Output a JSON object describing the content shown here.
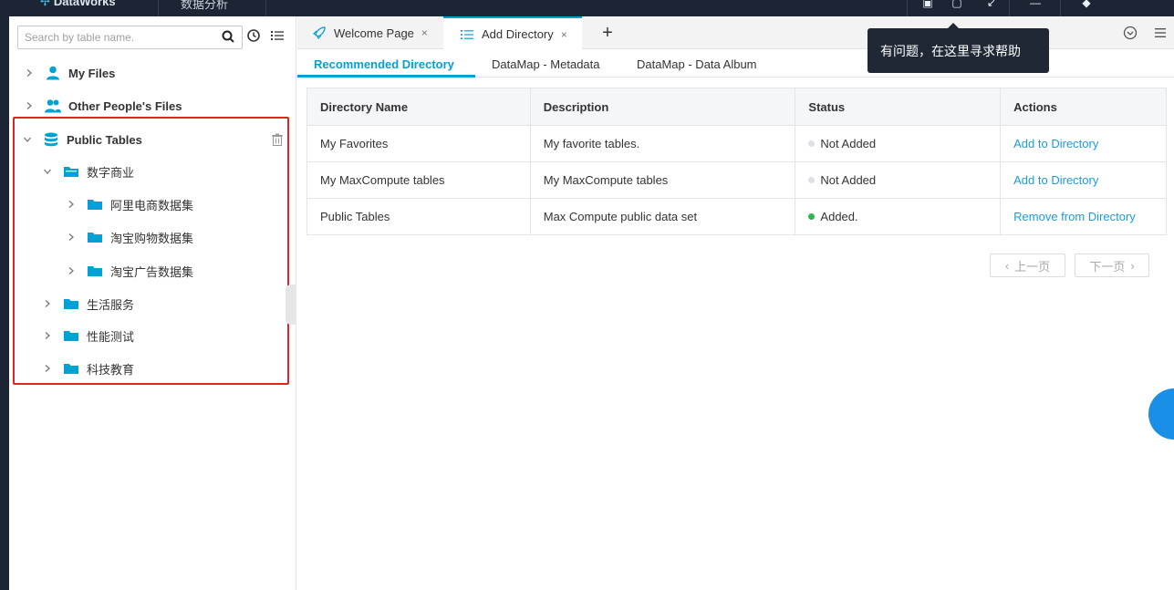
{
  "topbar": {
    "brand": "DataWorks",
    "workspace": "数据分析"
  },
  "sidebar": {
    "search_placeholder": "Search by table name.",
    "tree": [
      {
        "label": "My Files",
        "bold": true,
        "icon": "user-icon"
      },
      {
        "label": "Other People's Files",
        "bold": true,
        "icon": "users-icon"
      },
      {
        "label": "Public Tables",
        "bold": true,
        "icon": "database-icon",
        "expanded": true
      },
      {
        "label": "数字商业",
        "expanded": true,
        "icon": "folder-open-icon"
      },
      {
        "label": "阿里电商数据集",
        "icon": "folder-icon"
      },
      {
        "label": "淘宝购物数据集",
        "icon": "folder-icon"
      },
      {
        "label": "淘宝广告数据集",
        "icon": "folder-icon"
      },
      {
        "label": "生活服务",
        "icon": "folder-icon"
      },
      {
        "label": "性能测试",
        "icon": "folder-icon"
      },
      {
        "label": "科技教育",
        "icon": "folder-icon"
      }
    ]
  },
  "tabs": [
    {
      "label": "Welcome Page",
      "active": false
    },
    {
      "label": "Add Directory",
      "active": true
    }
  ],
  "subtabs": [
    {
      "label": "Recommended Directory",
      "active": true
    },
    {
      "label": "DataMap - Metadata",
      "active": false
    },
    {
      "label": "DataMap - Data Album",
      "active": false
    }
  ],
  "table": {
    "headers": [
      "Directory Name",
      "Description",
      "Status",
      "Actions"
    ],
    "rows": [
      {
        "name": "My Favorites",
        "description": "My favorite tables.",
        "status": "Not Added",
        "action": "Add to Directory"
      },
      {
        "name": "My MaxCompute tables",
        "description": "My MaxCompute tables",
        "status": "Not Added",
        "action": "Add to Directory"
      },
      {
        "name": "Public Tables",
        "description": "Max Compute public data set",
        "status": "Added.",
        "action": "Remove from Directory"
      }
    ]
  },
  "pager": {
    "prev": "上一页",
    "next": "下一页"
  },
  "tooltip": "有问题，在这里寻求帮助",
  "colors": {
    "accent": "#00a2d4",
    "link": "#1e9be0",
    "status_added": "#2db84d",
    "status_not_added": "#dcdfe4",
    "highlight": "#e0261c",
    "topbar": "#1b2533"
  }
}
